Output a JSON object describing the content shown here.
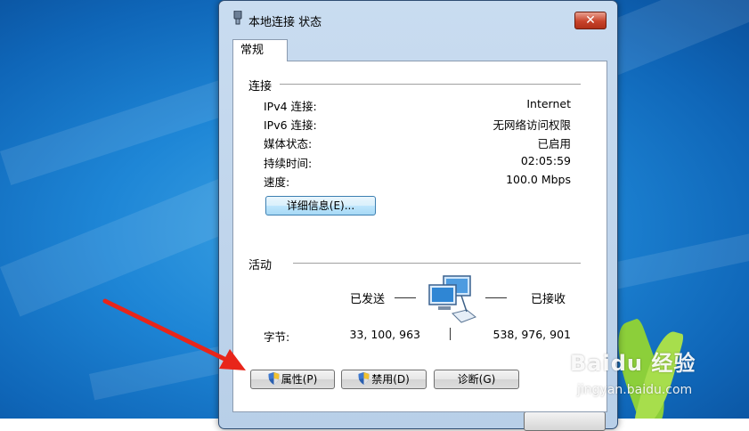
{
  "window": {
    "title": "本地连接 状态"
  },
  "tabs": [
    {
      "label": "常规"
    }
  ],
  "connection": {
    "heading": "连接",
    "rows": [
      {
        "label": "IPv4 连接:",
        "value": "Internet"
      },
      {
        "label": "IPv6 连接:",
        "value": "无网络访问权限"
      },
      {
        "label": "媒体状态:",
        "value": "已启用"
      },
      {
        "label": "持续时间:",
        "value": "02:05:59"
      },
      {
        "label": "速度:",
        "value": "100.0 Mbps"
      }
    ],
    "details_button": "详细信息(E)..."
  },
  "activity": {
    "heading": "活动",
    "sent_label": "已发送",
    "received_label": "已接收",
    "bytes_label": "字节:",
    "bytes_sent": "33, 100, 963",
    "bytes_received": "538, 976, 901"
  },
  "buttons": {
    "properties": "属性(P)",
    "disable": "禁用(D)",
    "diagnose": "诊断(G)"
  },
  "watermark": {
    "logo": "Baidu 经验",
    "url": "jingyan.baidu.com"
  },
  "colors": {
    "desktop": "#1e86d6",
    "close_button": "#c8432b",
    "arrow": "#e8251a",
    "details_button": "#bee6fd"
  },
  "icons": [
    "network-adapter-icon",
    "close-icon",
    "uac-shield-icon",
    "network-computers-icon",
    "arrow-pointer"
  ]
}
